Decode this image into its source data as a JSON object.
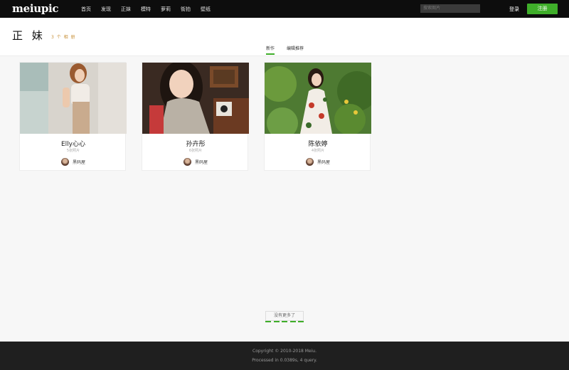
{
  "topbar": {
    "logo": "meiupic",
    "nav": [
      "首页",
      "发现",
      "正妹",
      "模特",
      "萝莉",
      "街拍",
      "壁纸"
    ],
    "search_placeholder": "搜索图片",
    "login": "登录",
    "register": "注册"
  },
  "header": {
    "title": "正 妹",
    "count": "3 个 相 册",
    "tabs": [
      "新作",
      "编辑推荐"
    ],
    "active_tab": "新作"
  },
  "cards": [
    {
      "name": "Elly心心",
      "sub": "5张照片",
      "author": "黑码屋"
    },
    {
      "name": "孙卉彤",
      "sub": "6张照片",
      "author": "黑码屋"
    },
    {
      "name": "陈依婷",
      "sub": "4张照片",
      "author": "黑码屋"
    }
  ],
  "load_more": "没有更多了",
  "footer": {
    "copyright": "Copyright © 2010-2018 Meiu.",
    "processed": "Processed in 0.0389s, 4 query."
  },
  "colors": {
    "accent": "#3fae2a",
    "topbar": "#0d0d0d",
    "footer": "#1f1f1f",
    "count": "#c8913a"
  }
}
